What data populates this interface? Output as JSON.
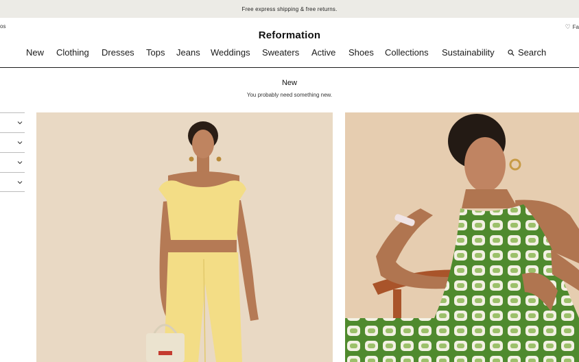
{
  "promo": {
    "text": "Free express shipping & free returns."
  },
  "utility": {
    "left_text": "os",
    "right_text": "Fa",
    "right_icon": "heart-icon"
  },
  "brand": {
    "name": "Reformation"
  },
  "nav": {
    "items": [
      {
        "label": "New"
      },
      {
        "label": "Clothing"
      },
      {
        "label": "Dresses"
      },
      {
        "label": "Tops"
      },
      {
        "label": "Jeans"
      },
      {
        "label": "Weddings"
      },
      {
        "label": "Sweaters"
      },
      {
        "label": "Active"
      },
      {
        "label": "Shoes"
      },
      {
        "label": "Collections"
      },
      {
        "label": "Sustainability"
      }
    ],
    "search_label": "Search",
    "search_icon": "search-icon"
  },
  "page": {
    "title": "New",
    "subtitle": "You probably need something new."
  },
  "filters": {
    "count": 4,
    "icon": "chevron-down-icon"
  },
  "products": [
    {
      "image": "model in yellow off-shoulder crop top and yellow trousers holding a cream handbag"
    },
    {
      "image": "model in green and white geometric print halter dress seated on wooden chair"
    }
  ],
  "colors": {
    "promo_bg": "#ecebe6",
    "text": "#1a1a1a",
    "card1_bg": "#e9d9c4",
    "card2_bg": "#e6cdb0",
    "yellow_outfit": "#f3dd86",
    "green_print": "#4f8a2e"
  }
}
